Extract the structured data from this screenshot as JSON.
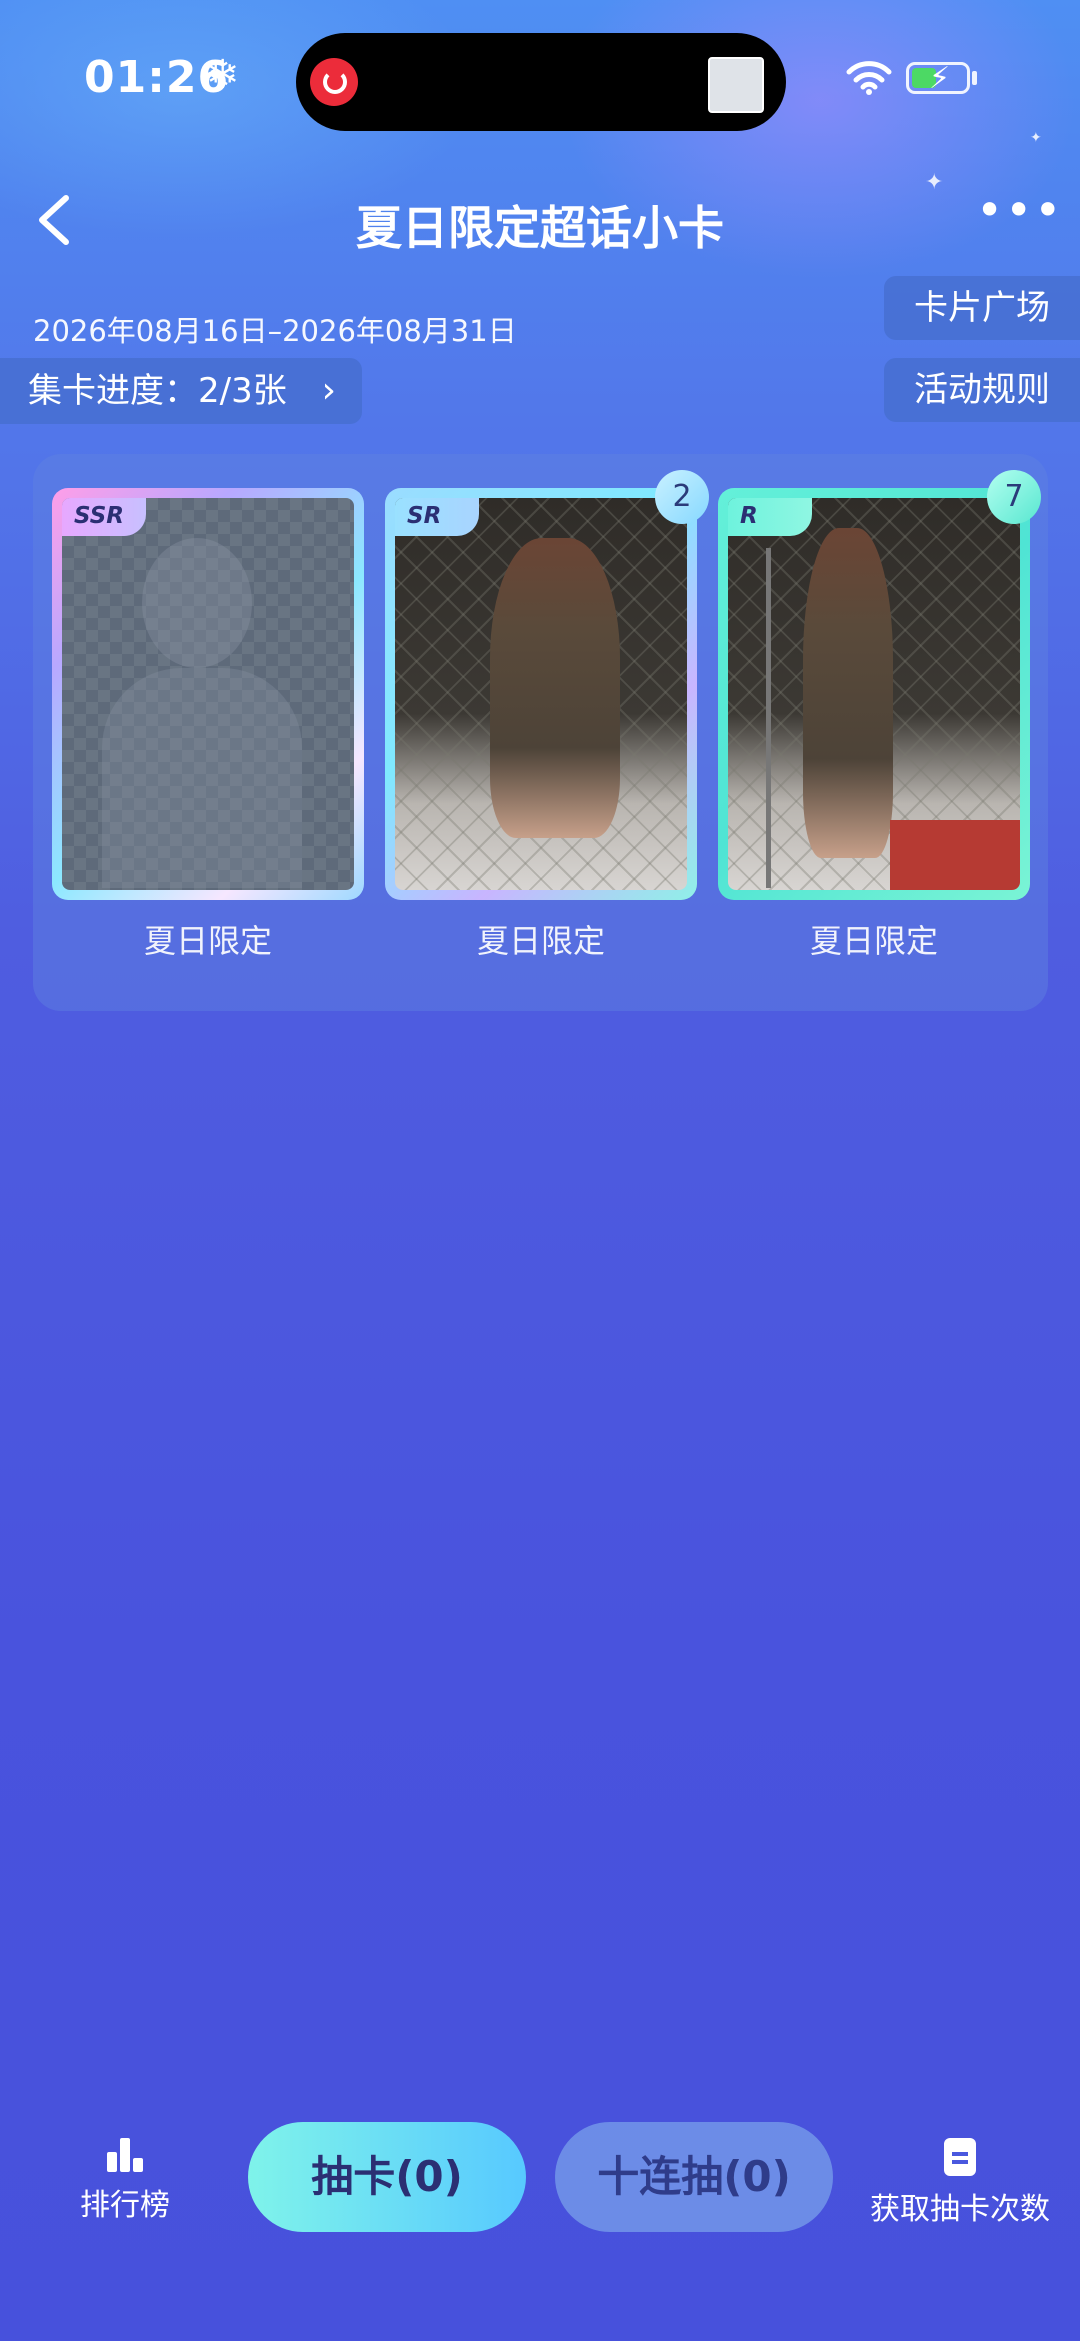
{
  "status_bar": {
    "time": "01:26"
  },
  "header": {
    "title": "夏日限定超话小卡",
    "date_range": "2026年08月16日–2026年08月31日",
    "card_square_label": "卡片广场",
    "rules_label": "活动规则",
    "progress_label": "集卡进度：2/3张"
  },
  "cards": [
    {
      "rarity": "SSR",
      "name": "夏日限定",
      "count": ""
    },
    {
      "rarity": "SR",
      "name": "夏日限定",
      "count": "2"
    },
    {
      "rarity": "R",
      "name": "夏日限定",
      "count": "7"
    }
  ],
  "bottom_bar": {
    "leaderboard_label": "排行榜",
    "draw_label": "抽卡(0)",
    "ten_draw_label": "十连抽(0)",
    "get_draws_label": "获取抽卡次数"
  },
  "colors": {
    "background": "#4953dd",
    "draw_button": "#7ff3ea",
    "accent_teal": "#58e7d0"
  }
}
